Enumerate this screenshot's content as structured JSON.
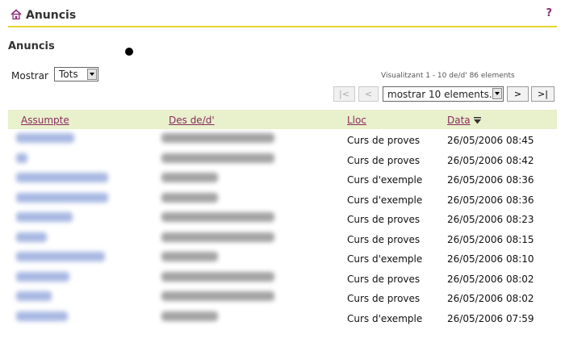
{
  "header": {
    "title": "Anuncis",
    "help": "?"
  },
  "section": {
    "title": "Anuncis"
  },
  "filter": {
    "label": "Mostrar",
    "value": "Tots"
  },
  "pagination": {
    "viewing": "Visualitzant 1 - 10 de/d' 86 elements",
    "first": "|<",
    "prev": "<",
    "page_size": "mostrar 10 elements...",
    "next": ">",
    "last": ">|"
  },
  "table": {
    "columns": {
      "subject": "Assumpte",
      "from": "Des de/d'",
      "place": "Lloc",
      "date": "Data"
    },
    "rows": [
      {
        "place": "Curs de proves",
        "date": "26/05/2006 08:45"
      },
      {
        "place": "Curs de proves",
        "date": "26/05/2006 08:42"
      },
      {
        "place": "Curs d'exemple",
        "date": "26/05/2006 08:36"
      },
      {
        "place": "Curs d'exemple",
        "date": "26/05/2006 08:36"
      },
      {
        "place": "Curs de proves",
        "date": "26/05/2006 08:23"
      },
      {
        "place": "Curs de proves",
        "date": "26/05/2006 08:15"
      },
      {
        "place": "Curs d'exemple",
        "date": "26/05/2006 08:10"
      },
      {
        "place": "Curs de proves",
        "date": "26/05/2006 08:02"
      },
      {
        "place": "Curs de proves",
        "date": "26/05/2006 08:02"
      },
      {
        "place": "Curs d'exemple",
        "date": "26/05/2006 07:59"
      }
    ]
  },
  "colors": {
    "accent_line": "#e5d530",
    "header_bg": "#e8f0cc",
    "link": "#8a2c5c"
  }
}
